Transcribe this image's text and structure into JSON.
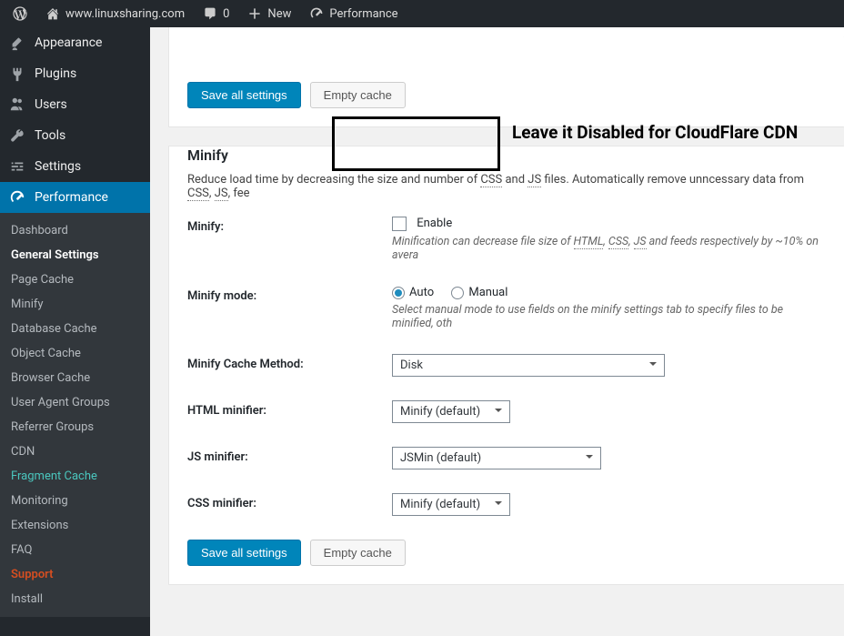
{
  "adminbar": {
    "site_url": "www.linuxsharing.com",
    "comments_count": "0",
    "new_label": "New",
    "perf_label": "Performance"
  },
  "sidebar": {
    "appearance": "Appearance",
    "plugins": "Plugins",
    "users": "Users",
    "tools": "Tools",
    "settings": "Settings",
    "performance": "Performance",
    "submenu": {
      "dashboard": "Dashboard",
      "general": "General Settings",
      "page_cache": "Page Cache",
      "minify": "Minify",
      "db_cache": "Database Cache",
      "obj_cache": "Object Cache",
      "browser_cache": "Browser Cache",
      "ua_groups": "User Agent Groups",
      "ref_groups": "Referrer Groups",
      "cdn": "CDN",
      "frag_cache": "Fragment Cache",
      "monitoring": "Monitoring",
      "extensions": "Extensions",
      "faq": "FAQ",
      "support": "Support",
      "install": "Install"
    }
  },
  "buttons": {
    "save_all": "Save all settings",
    "empty_cache": "Empty cache"
  },
  "minify": {
    "heading": "Minify",
    "desc_pre": "Reduce load time by decreasing the size and number of ",
    "css_abbr": "CSS",
    "and": " and ",
    "js_abbr": "JS",
    "desc_post": " files. Automatically remove unncessary data from ",
    "desc_tail": ", fee",
    "label": "Minify:",
    "enable": "Enable",
    "hint_pre": "Minification can decrease file size of ",
    "html_abbr": "HTML",
    "hint_mid": " and feeds respectively by ~10% on avera",
    "comma": ", ",
    "mode_label": "Minify mode:",
    "mode_auto": "Auto",
    "mode_manual": "Manual",
    "mode_hint": "Select manual mode to use fields on the minify settings tab to specify files to be minified, oth",
    "cache_method_label": "Minify Cache Method:",
    "cache_method_value": "Disk",
    "html_min_label": "HTML minifier:",
    "html_min_value": "Minify (default)",
    "js_min_label": "JS minifier:",
    "js_min_value": "JSMin (default)",
    "css_min_label": "CSS minifier:",
    "css_min_value": "Minify (default)"
  },
  "annotation": {
    "text": "Leave it Disabled for CloudFlare CDN"
  }
}
